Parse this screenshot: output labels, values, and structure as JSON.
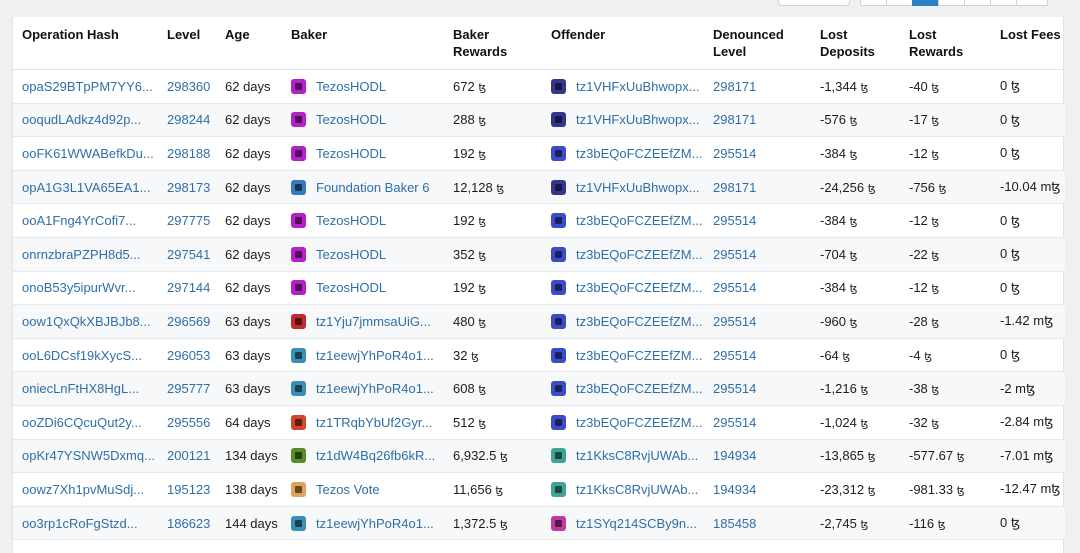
{
  "columns": {
    "op_hash": "Operation Hash",
    "level": "Level",
    "age": "Age",
    "baker": "Baker",
    "baker_rewards": "Baker Rewards",
    "offender": "Offender",
    "denounced_level": "Denounced Level",
    "lost_deposits": "Lost Deposits",
    "lost_rewards": "Lost Rewards",
    "lost_fees": "Lost Fees"
  },
  "rows": [
    {
      "hash": "opaS29BTpPM7YY6...",
      "level": "298360",
      "age": "62 days",
      "baker": "TezosHODL",
      "baker_color": "#b620c9",
      "rewards": "672",
      "offender": "tz1VHFxUuBhwopx...",
      "offender_color": "#34358c",
      "denounced": "298171",
      "deposits": "-1,344",
      "lost_rewards": "-40",
      "fees": "0 ꜩ"
    },
    {
      "hash": "ooqudLAdkz4d92p...",
      "level": "298244",
      "age": "62 days",
      "baker": "TezosHODL",
      "baker_color": "#b620c9",
      "rewards": "288",
      "offender": "tz1VHFxUuBhwopx...",
      "offender_color": "#34358c",
      "denounced": "298171",
      "deposits": "-576",
      "lost_rewards": "-17",
      "fees": "0 ꜩ"
    },
    {
      "hash": "ooFK61WWABefkDu...",
      "level": "298188",
      "age": "62 days",
      "baker": "TezosHODL",
      "baker_color": "#b620c9",
      "rewards": "192",
      "offender": "tz3bEQoFCZEEfZM...",
      "offender_color": "#3c4bc9",
      "denounced": "295514",
      "deposits": "-384",
      "lost_rewards": "-12",
      "fees": "0 ꜩ"
    },
    {
      "hash": "opA1G3L1VA65EA1...",
      "level": "298173",
      "age": "62 days",
      "baker": "Foundation Baker 6",
      "baker_color": "#3a78c2",
      "rewards": "12,128",
      "offender": "tz1VHFxUuBhwopx...",
      "offender_color": "#34358c",
      "denounced": "298171",
      "deposits": "-24,256",
      "lost_rewards": "-756",
      "fees": "-10.04 mꜩ"
    },
    {
      "hash": "ooA1Fng4YrCofi7...",
      "level": "297775",
      "age": "62 days",
      "baker": "TezosHODL",
      "baker_color": "#b620c9",
      "rewards": "192",
      "offender": "tz3bEQoFCZEEfZM...",
      "offender_color": "#3c4bc9",
      "denounced": "295514",
      "deposits": "-384",
      "lost_rewards": "-12",
      "fees": "0 ꜩ"
    },
    {
      "hash": "onrnzbraPZPH8d5...",
      "level": "297541",
      "age": "62 days",
      "baker": "TezosHODL",
      "baker_color": "#b620c9",
      "rewards": "352",
      "offender": "tz3bEQoFCZEEfZM...",
      "offender_color": "#3c4bc9",
      "denounced": "295514",
      "deposits": "-704",
      "lost_rewards": "-22",
      "fees": "0 ꜩ"
    },
    {
      "hash": "onoB53y5ipurWvr...",
      "level": "297144",
      "age": "62 days",
      "baker": "TezosHODL",
      "baker_color": "#b620c9",
      "rewards": "192",
      "offender": "tz3bEQoFCZEEfZM...",
      "offender_color": "#3c4bc9",
      "denounced": "295514",
      "deposits": "-384",
      "lost_rewards": "-12",
      "fees": "0 ꜩ"
    },
    {
      "hash": "oow1QxQkXBJBJb8...",
      "level": "296569",
      "age": "63 days",
      "baker": "tz1Yju7jmmsaUiG...",
      "baker_color": "#c02a2a",
      "rewards": "480",
      "offender": "tz3bEQoFCZEEfZM...",
      "offender_color": "#3c4bc9",
      "denounced": "295514",
      "deposits": "-960",
      "lost_rewards": "-28",
      "fees": "-1.42 mꜩ"
    },
    {
      "hash": "ooL6DCsf19kXycS...",
      "level": "296053",
      "age": "63 days",
      "baker": "tz1eewjYhPoR4o1...",
      "baker_color": "#3a8fb5",
      "rewards": "32",
      "offender": "tz3bEQoFCZEEfZM...",
      "offender_color": "#3c4bc9",
      "denounced": "295514",
      "deposits": "-64",
      "lost_rewards": "-4",
      "fees": "0 ꜩ"
    },
    {
      "hash": "oniecLnFtHX8HgL...",
      "level": "295777",
      "age": "63 days",
      "baker": "tz1eewjYhPoR4o1...",
      "baker_color": "#3a8fb5",
      "rewards": "608",
      "offender": "tz3bEQoFCZEEfZM...",
      "offender_color": "#3c4bc9",
      "denounced": "295514",
      "deposits": "-1,216",
      "lost_rewards": "-38",
      "fees": "-2 mꜩ"
    },
    {
      "hash": "ooZDi6CQcuQut2y...",
      "level": "295556",
      "age": "64 days",
      "baker": "tz1TRqbYbUf2Gyr...",
      "baker_color": "#d0452c",
      "rewards": "512",
      "offender": "tz3bEQoFCZEEfZM...",
      "offender_color": "#3c4bc9",
      "denounced": "295514",
      "deposits": "-1,024",
      "lost_rewards": "-32",
      "fees": "-2.84 mꜩ"
    },
    {
      "hash": "opKr47YSNW5Dxmq...",
      "level": "200121",
      "age": "134 days",
      "baker": "tz1dW4Bq26fb6kR...",
      "baker_color": "#5a8c2a",
      "rewards": "6,932.5",
      "offender": "tz1KksC8RvjUWAb...",
      "offender_color": "#3fa39a",
      "denounced": "194934",
      "deposits": "-13,865",
      "lost_rewards": "-577.67",
      "fees": "-7.01 mꜩ"
    },
    {
      "hash": "oowz7Xh1pvMuSdj...",
      "level": "195123",
      "age": "138 days",
      "baker": "Tezos Vote",
      "baker_color": "#e0a35a",
      "rewards": "11,656",
      "offender": "tz1KksC8RvjUWAb...",
      "offender_color": "#3fa39a",
      "denounced": "194934",
      "deposits": "-23,312",
      "lost_rewards": "-981.33",
      "fees": "-12.47 mꜩ"
    },
    {
      "hash": "oo3rp1cRoFgStzd...",
      "level": "186623",
      "age": "144 days",
      "baker": "tz1eewjYhPoR4o1...",
      "baker_color": "#3a8fb5",
      "rewards": "1,372.5",
      "offender": "tz1SYq214SCBy9n...",
      "offender_color": "#c23aa0",
      "denounced": "185458",
      "deposits": "-2,745",
      "lost_rewards": "-116",
      "fees": "0 ꜩ"
    }
  ],
  "tez_symbol": "ꜩ"
}
